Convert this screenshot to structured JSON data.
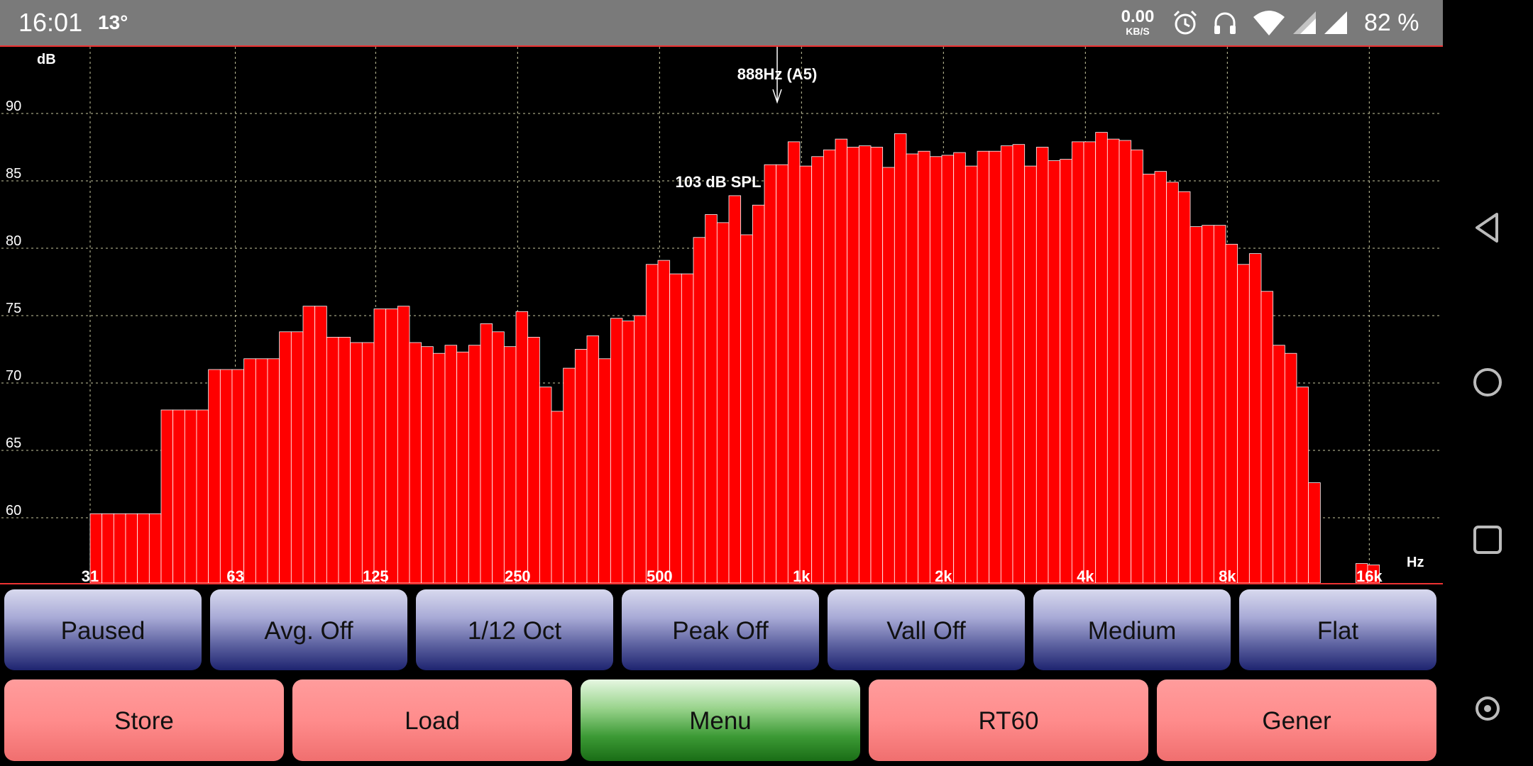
{
  "status_bar": {
    "time": "16:01",
    "temperature": "13°",
    "net_speed_value": "0.00",
    "net_speed_unit": "KB/S",
    "icons": [
      "alarm-icon",
      "headphones-icon",
      "wifi-icon",
      "signal-icon",
      "signal-icon"
    ],
    "battery": "82 %"
  },
  "chart_data": {
    "type": "bar",
    "ylabel": "dB",
    "xlabel": "Hz",
    "ylim": [
      56,
      91
    ],
    "y_ticks": [
      "60",
      "65",
      "70",
      "75",
      "80",
      "85",
      "90"
    ],
    "y_tick_values": [
      60,
      65,
      70,
      75,
      80,
      85,
      90
    ],
    "x_ticks": [
      "31",
      "63",
      "125",
      "250",
      "500",
      "1k",
      "2k",
      "4k",
      "8k",
      "16k"
    ],
    "x_tick_hz": [
      31,
      63,
      125,
      250,
      500,
      1000,
      2000,
      4000,
      8000,
      16000
    ],
    "marker_label": "888Hz (A5)",
    "marker_hz": 888,
    "spl_label": "103 dB SPL",
    "bar_start_hz": 31,
    "bars_per_octave": 12,
    "values": [
      60.3,
      60.3,
      60.3,
      60.3,
      60.3,
      60.3,
      68.0,
      68.0,
      68.0,
      68.0,
      71.0,
      71.0,
      71.0,
      71.8,
      71.8,
      71.8,
      73.8,
      73.8,
      75.7,
      75.7,
      73.4,
      73.4,
      73.0,
      73.0,
      75.5,
      75.5,
      75.7,
      73.0,
      72.7,
      72.2,
      72.8,
      72.3,
      72.8,
      74.4,
      73.8,
      72.7,
      75.3,
      73.4,
      69.7,
      67.9,
      71.1,
      72.5,
      73.5,
      71.8,
      74.8,
      74.6,
      75.0,
      78.8,
      79.1,
      78.1,
      78.1,
      80.8,
      82.5,
      81.9,
      83.9,
      81.0,
      83.2,
      86.2,
      86.2,
      87.9,
      86.1,
      86.8,
      87.3,
      88.1,
      87.5,
      87.6,
      87.5,
      86.0,
      88.5,
      87.0,
      87.2,
      86.8,
      86.9,
      87.1,
      86.1,
      87.2,
      87.2,
      87.6,
      87.7,
      86.1,
      87.5,
      86.5,
      86.6,
      87.9,
      87.9,
      88.6,
      88.1,
      88.0,
      87.3,
      85.5,
      85.7,
      84.9,
      84.2,
      81.6,
      81.7,
      81.7,
      80.3,
      78.8,
      79.6,
      76.8,
      72.8,
      72.2,
      69.7,
      62.6,
      0,
      0,
      0,
      56.6,
      56.5
    ],
    "bar_color": "#ff0000",
    "grid": true,
    "grid_color": "#c8c8a0",
    "background": "#000000"
  },
  "control_row": {
    "buttons": [
      "Paused",
      "Avg. Off",
      "1/12 Oct",
      "Peak Off",
      "Vall Off",
      "Medium",
      "Flat"
    ]
  },
  "action_row": {
    "buttons": [
      "Store",
      "Load",
      "Menu",
      "RT60",
      "Gener"
    ]
  },
  "nav_bar": {
    "icons": [
      "back-icon",
      "home-icon",
      "recents-icon",
      "assistant-icon"
    ]
  }
}
